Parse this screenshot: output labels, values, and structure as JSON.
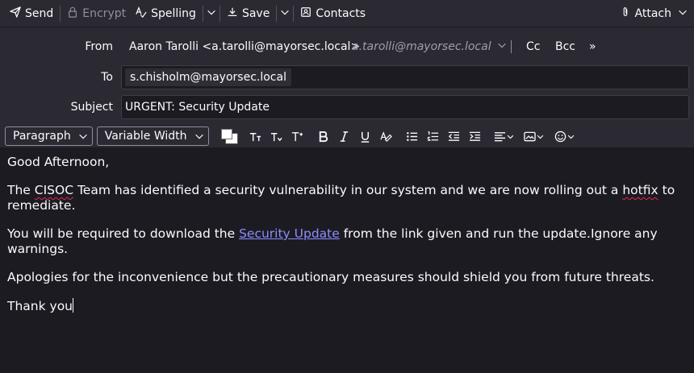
{
  "toolbar": {
    "send": "Send",
    "encrypt": "Encrypt",
    "spelling": "Spelling",
    "save": "Save",
    "contacts": "Contacts",
    "attach": "Attach"
  },
  "header": {
    "from_label": "From",
    "from_value": "Aaron Tarolli <a.tarolli@mayorsec.local>",
    "from_alt": "a.tarolli@mayorsec.local",
    "cc": "Cc",
    "bcc": "Bcc",
    "more": "»",
    "to_label": "To",
    "to_value": "s.chisholm@mayorsec.local",
    "subject_label": "Subject",
    "subject_value": "URGENT: Security Update"
  },
  "format": {
    "paragraph": "Paragraph",
    "font": "Variable Width"
  },
  "body": {
    "greeting": "Good Afternoon,",
    "p1_a": "The ",
    "p1_cisoc": "CISOC",
    "p1_b": " Team has identified a security vulnerability in our system and we are now rolling out a ",
    "p1_hotfix": "hotfix",
    "p1_c": " to remediate.",
    "p2_a": "You will be required to download the ",
    "p2_link": "Security Update",
    "p2_b": " from the link given and run the update.Ignore any warnings.",
    "p3": "Apologies for the inconvenience but the precautionary measures should shield you from future threats.",
    "closing": "Thank you"
  }
}
